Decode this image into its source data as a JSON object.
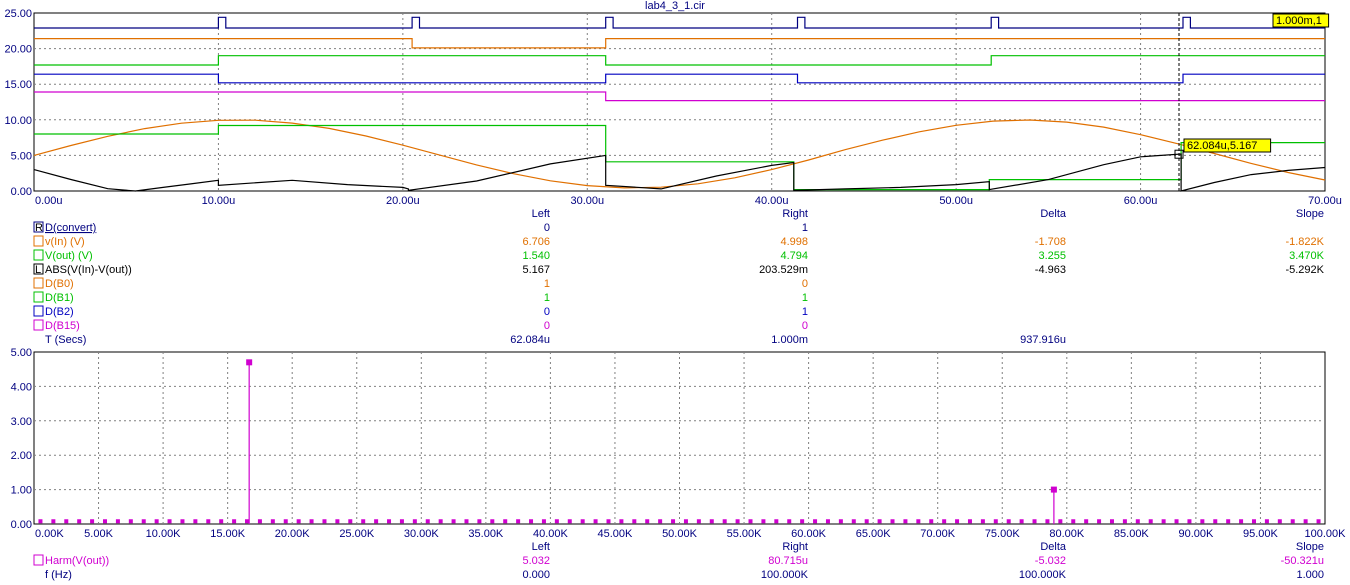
{
  "window": {
    "title": "lab4_3_1.cir"
  },
  "chart_data": [
    {
      "type": "line",
      "title": "lab4_3_1.cir",
      "xlim": [
        0,
        70
      ],
      "ylim": [
        0,
        25
      ],
      "x_ticks": [
        "0.00u",
        "10.00u",
        "20.00u",
        "30.00u",
        "40.00u",
        "50.00u",
        "60.00u",
        "70.00u"
      ],
      "y_ticks": [
        "0.00",
        "5.00",
        "10.00",
        "15.00",
        "20.00",
        "25.00"
      ],
      "grid": true,
      "cursor_labels": [
        "1.000m,1",
        "62.084u,5.167"
      ],
      "cursor": {
        "x": 62.084,
        "y": 5.167
      },
      "series": [
        {
          "name": "D(convert)",
          "color": "#000080",
          "digital": true,
          "base": 22.9,
          "high": 24.4,
          "edges": [
            [
              0,
              0
            ],
            [
              10,
              1
            ],
            [
              10.4,
              0
            ],
            [
              20.5,
              1
            ],
            [
              20.9,
              0
            ],
            [
              31,
              1
            ],
            [
              31.4,
              0
            ],
            [
              41.4,
              1
            ],
            [
              41.8,
              0
            ],
            [
              51.9,
              1
            ],
            [
              52.3,
              0
            ],
            [
              62.3,
              1
            ],
            [
              62.7,
              0
            ],
            [
              70,
              0
            ]
          ]
        },
        {
          "name": "D(B0)",
          "color": "#e07000",
          "digital": true,
          "base": 20.1,
          "high": 21.4,
          "edges": [
            [
              0,
              1
            ],
            [
              20.5,
              0
            ],
            [
              31,
              1
            ],
            [
              70,
              1
            ]
          ]
        },
        {
          "name": "D(B1)",
          "color": "#00c000",
          "digital": true,
          "base": 17.7,
          "high": 19.0,
          "edges": [
            [
              0,
              0
            ],
            [
              10,
              1
            ],
            [
              31,
              0
            ],
            [
              51.9,
              1
            ],
            [
              70,
              1
            ]
          ]
        },
        {
          "name": "D(B2)",
          "color": "#0000c0",
          "digital": true,
          "base": 15.2,
          "high": 16.4,
          "edges": [
            [
              0,
              1
            ],
            [
              10,
              0
            ],
            [
              31,
              1
            ],
            [
              41.4,
              0
            ],
            [
              62.3,
              1
            ],
            [
              70,
              1
            ]
          ]
        },
        {
          "name": "D(B15)",
          "color": "#d000d0",
          "digital": true,
          "base": 12.7,
          "high": 13.9,
          "edges": [
            [
              0,
              1
            ],
            [
              10,
              1
            ],
            [
              31,
              0
            ],
            [
              70,
              0
            ]
          ]
        },
        {
          "name": "v(In) (V)",
          "color": "#e07000",
          "digital": false,
          "x": [
            0,
            2,
            4,
            6,
            8,
            10,
            12,
            14,
            16,
            18,
            20,
            22,
            24,
            26,
            28,
            30,
            32,
            34,
            36,
            38,
            40,
            42,
            44,
            46,
            48,
            50,
            52,
            54,
            56,
            58,
            60,
            62,
            64,
            66,
            68,
            70
          ],
          "y": [
            5.0,
            6.39,
            7.68,
            8.76,
            9.52,
            9.93,
            9.94,
            9.54,
            8.79,
            7.72,
            6.43,
            5.04,
            3.66,
            2.43,
            1.43,
            0.76,
            0.44,
            0.53,
            1.01,
            1.85,
            3.0,
            4.35,
            5.82,
            7.13,
            8.31,
            9.23,
            9.82,
            9.97,
            9.68,
            8.97,
            7.91,
            6.64,
            5.26,
            3.87,
            2.6,
            1.55
          ]
        },
        {
          "name": "V(out) (V)",
          "color": "#00c000",
          "digital": false,
          "stepped": true,
          "x": [
            0,
            10,
            10,
            31,
            31,
            41.2,
            41.2,
            51.8,
            51.8,
            62.2,
            62.2,
            70
          ],
          "y": [
            8.0,
            8.0,
            9.2,
            9.2,
            4.1,
            4.1,
            0.2,
            0.2,
            1.6,
            1.6,
            6.8,
            6.8
          ]
        },
        {
          "name": "ABS(V(In)-V(out))",
          "color": "#000000",
          "digital": false,
          "x": [
            0,
            2,
            4,
            5.5,
            7,
            8.5,
            10,
            10,
            14,
            17,
            20,
            20.3,
            20.3,
            24,
            28,
            31,
            31,
            34,
            37,
            40,
            41.2,
            41.2,
            44,
            47,
            50,
            51.8,
            51.8,
            55,
            58,
            60,
            62.2,
            62.2,
            64,
            66,
            68,
            70
          ],
          "y": [
            3.0,
            1.61,
            0.32,
            0.0,
            0.5,
            1.0,
            1.5,
            0.8,
            1.5,
            0.9,
            0.5,
            0.3,
            0.1,
            1.4,
            3.8,
            5.0,
            0.8,
            0.3,
            2.1,
            3.6,
            4.0,
            0.1,
            0.3,
            0.5,
            0.9,
            1.3,
            0.2,
            1.6,
            3.7,
            4.8,
            5.2,
            0.0,
            1.2,
            2.3,
            2.9,
            3.3
          ]
        }
      ]
    },
    {
      "type": "bar",
      "xlim": [
        0,
        100
      ],
      "ylim": [
        0,
        5
      ],
      "x_ticks": [
        "0.00K",
        "5.00K",
        "10.00K",
        "15.00K",
        "20.00K",
        "25.00K",
        "30.00K",
        "35.00K",
        "40.00K",
        "45.00K",
        "50.00K",
        "55.00K",
        "60.00K",
        "65.00K",
        "70.00K",
        "75.00K",
        "80.00K",
        "85.00K",
        "90.00K",
        "95.00K",
        "100.00K"
      ],
      "y_ticks": [
        "0.00",
        "1.00",
        "2.00",
        "3.00",
        "4.00",
        "5.00"
      ],
      "grid": true,
      "series": [
        {
          "name": "Harm(V(out))",
          "color": "#d000d0",
          "peaks": [
            [
              16.667,
              4.7
            ],
            [
              79.0,
              1.0
            ]
          ],
          "floor": 0.08,
          "spacing": 1.0,
          "floor_start": 0.5
        }
      ]
    }
  ],
  "table": {
    "headers": [
      "Left",
      "Right",
      "Delta",
      "Slope"
    ],
    "rows": [
      {
        "marker": "R",
        "name": "D(convert)",
        "color": "#000080",
        "left": "0",
        "right": "1",
        "delta": "",
        "slope": ""
      },
      {
        "marker": "",
        "name": "v(In) (V)",
        "color": "#e07000",
        "left": "6.706",
        "right": "4.998",
        "delta": "-1.708",
        "slope": "-1.822K"
      },
      {
        "marker": "",
        "name": "V(out) (V)",
        "color": "#00c000",
        "left": "1.540",
        "right": "4.794",
        "delta": "3.255",
        "slope": "3.470K"
      },
      {
        "marker": "L",
        "name": "ABS(V(In)-V(out))",
        "color": "#000000",
        "left": "5.167",
        "right": "203.529m",
        "delta": "-4.963",
        "slope": "-5.292K"
      },
      {
        "marker": "",
        "name": "D(B0)",
        "color": "#e07000",
        "left": "1",
        "right": "0",
        "delta": "",
        "slope": ""
      },
      {
        "marker": "",
        "name": "D(B1)",
        "color": "#00c000",
        "left": "1",
        "right": "1",
        "delta": "",
        "slope": ""
      },
      {
        "marker": "",
        "name": "D(B2)",
        "color": "#0000c0",
        "left": "0",
        "right": "1",
        "delta": "",
        "slope": ""
      },
      {
        "marker": "",
        "name": "D(B15)",
        "color": "#d000d0",
        "left": "0",
        "right": "0",
        "delta": "",
        "slope": ""
      }
    ],
    "xrow": {
      "name": "T (Secs)",
      "left": "62.084u",
      "right": "1.000m",
      "delta": "937.916u",
      "slope": ""
    }
  },
  "table2": {
    "headers": [
      "Left",
      "Right",
      "Delta",
      "Slope"
    ],
    "rows": [
      {
        "marker": "",
        "name": "Harm(V(out))",
        "color": "#d000d0",
        "left": "5.032",
        "right": "80.715u",
        "delta": "-5.032",
        "slope": "-50.321u"
      }
    ],
    "xrow": {
      "name": "f (Hz)",
      "left": "0.000",
      "right": "100.000K",
      "delta": "100.000K",
      "slope": "1.000"
    }
  }
}
